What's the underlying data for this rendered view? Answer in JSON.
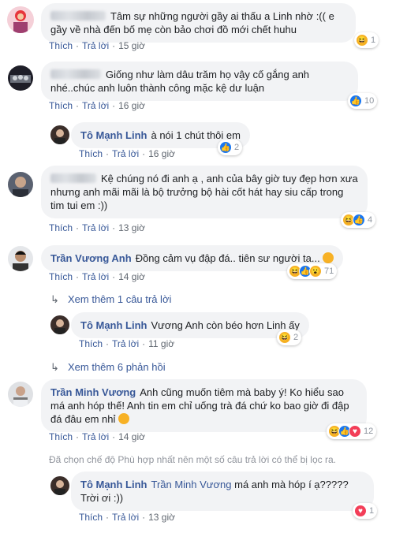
{
  "labels": {
    "like": "Thích",
    "reply": "Trả lời"
  },
  "comments": [
    {
      "text": "Tâm sự những người gầy ai thấu a Linh nhờ :(( e gầy về nhà đến bố mẹ còn bảo chơi đồ mới chết huhu",
      "time": "15 giờ",
      "reaction_count": "1"
    },
    {
      "text": "Giống như làm dâu trăm họ vậy cố gắng anh nhé..chúc anh luôn thành công mặc kệ dư luận",
      "time": "16 giờ",
      "reaction_count": "10"
    },
    {
      "author": "Tô Mạnh Linh",
      "text": "à nói 1 chút thôi em",
      "time": "16 giờ",
      "reaction_count": "2"
    },
    {
      "text": "Kệ chúng nó đi anh ạ , anh của bây giờ tuy đẹp hơn xưa nhưng anh mãi mãi là bộ trưởng bộ hài cốt hát hay siu cấp trong tim tui em :))",
      "time": "13 giờ",
      "reaction_count": "4"
    },
    {
      "author": "Trần Vương Anh",
      "text": "Đồng cảm vụ đập đá.. tiên sư người ta...",
      "time": "14 giờ",
      "reaction_count": "71"
    },
    {
      "author": "Tô Mạnh Linh",
      "text": "Vương Anh còn béo hơn Linh ấy",
      "time": "11 giờ",
      "reaction_count": "2"
    },
    {
      "author": "Trần Minh Vương",
      "text": "Anh cũng muốn tiêm mà baby ý! Ko hiểu sao má anh hóp thế! Anh tin em chỉ uống trà đá chứ ko bao giờ đi đập đá đâu em nhỉ",
      "time": "14 giờ",
      "reaction_count": "12"
    },
    {
      "author": "Tô Mạnh Linh",
      "mention": "Trần Minh Vương",
      "text": "má anh mà hóp í ạ????? Trời ơi :))",
      "time": "13 giờ",
      "reaction_count": "1"
    }
  ],
  "more_replies_1": "Xem thêm 1 câu trả lời",
  "more_replies_2": "Xem thêm 6 phản hồi",
  "filter_note": "Đã chọn chế độ Phù hợp nhất nên một số câu trả lời có thể bị lọc ra."
}
